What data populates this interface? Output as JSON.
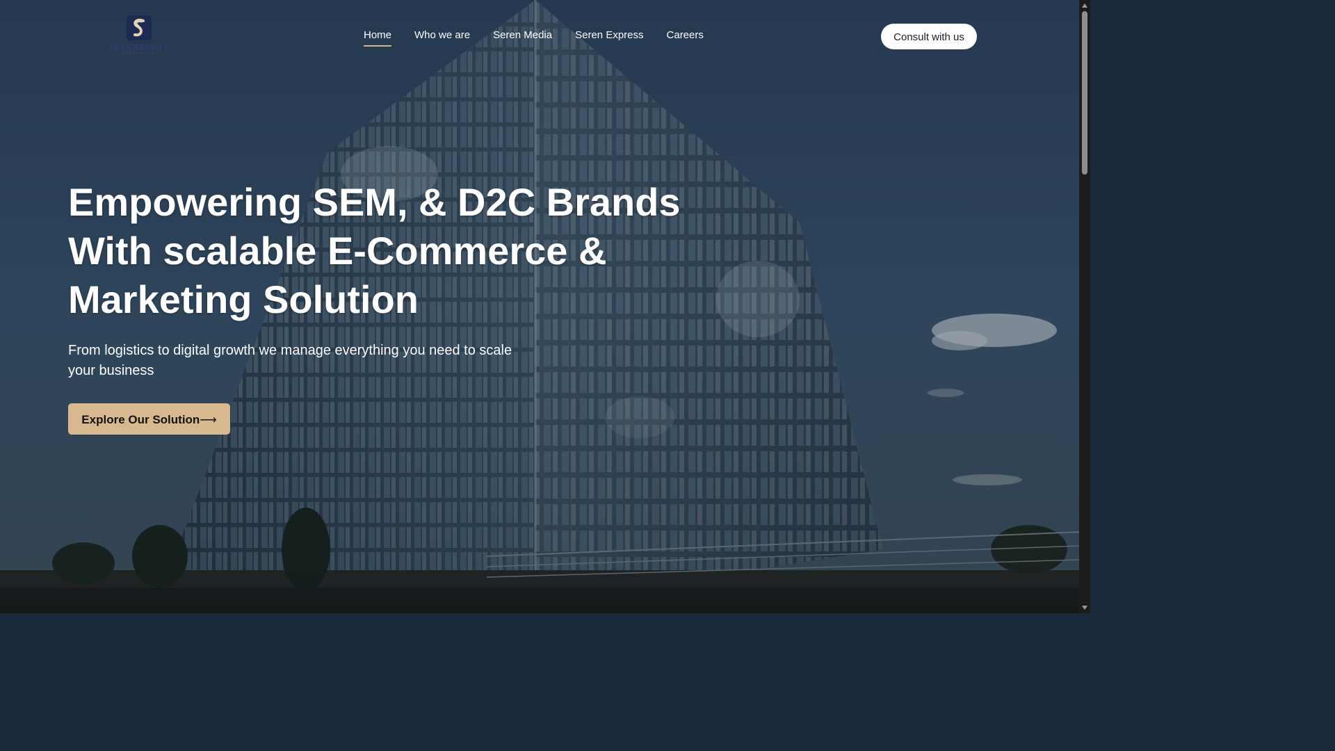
{
  "brand": {
    "name": "SERENSYNTH",
    "sub": "LABS PVT LTD",
    "colors": {
      "mark": "#1f2a52",
      "accent": "#d4b48c"
    }
  },
  "nav": {
    "items": [
      {
        "label": "Home",
        "active": true
      },
      {
        "label": "Who we are",
        "active": false
      },
      {
        "label": "Seren Media",
        "active": false
      },
      {
        "label": "Seren Express",
        "active": false
      },
      {
        "label": "Careers",
        "active": false
      }
    ]
  },
  "header": {
    "consult_label": "Consult with us"
  },
  "hero": {
    "title_lines": [
      "Empowering SEM, & D2C Brands",
      "With scalable E-Commerce &",
      "Marketing Solution"
    ],
    "subtitle": "From logistics to digital growth we manage everything you need to scale your business",
    "cta_label": "Explore Our Solution",
    "cta_arrow": "⟶",
    "cta_color": "#d8b98f"
  }
}
